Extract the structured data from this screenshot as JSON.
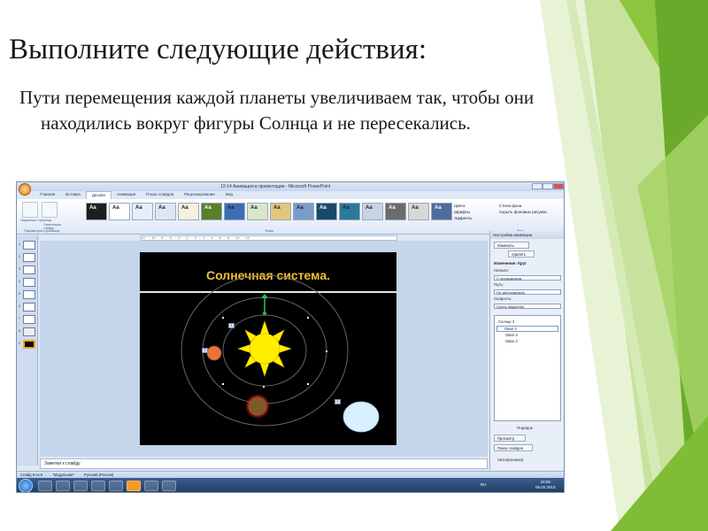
{
  "slide": {
    "title": "Выполните следующие действия:",
    "body": "Пути перемещения каждой планеты увеличиваем так, чтобы они находились вокруг фигуры Солнца и не пересекались."
  },
  "colors": {
    "accent_green": "#8cc63f",
    "slide_heading": "#f4c130",
    "sun": "#ffee00",
    "planet_mars": "#e8743b",
    "planet_earth": "#7a5a2a",
    "planet_ice": "#d8f0ff"
  },
  "app": {
    "window_title": "12-14 Анимация в презентации - Microsoft PowerPoint",
    "office_icon": "office-orb-icon",
    "tabs": [
      "Главная",
      "Вставка",
      "Дизайн",
      "Анимация",
      "Показ слайдов",
      "Рецензирование",
      "Вид"
    ],
    "active_tab": "Дизайн",
    "ribbon_page_buttons": [
      "Параметры страницы",
      "Ориентация слайда"
    ],
    "group_page_setup": "Параметры страницы",
    "group_themes": "Темы",
    "group_background": "Фон",
    "theme_tile_label": "Aa",
    "theme_options": [
      "Цвета",
      "Шрифты",
      "Эффекты"
    ],
    "background_options": [
      "Стили фона",
      "Скрыть фоновые рисунки"
    ],
    "ruler_text": "12 · · · 10 · · · 8 · · · 6 · · · 4 · · · 2 · · · 0 · · · 2 · · · 4 · · · 6 · · · 8 · · · 10 · · · 12",
    "thumb_numbers": [
      "1",
      "2",
      "3",
      "4",
      "5",
      "6",
      "7",
      "8",
      "9"
    ]
  },
  "embedded_slide": {
    "heading": "Солнечная система.",
    "marker_labels": [
      "1",
      "2",
      "3"
    ]
  },
  "notes": {
    "placeholder": "Заметки к слайду"
  },
  "task_pane": {
    "title": "Настройка анимации",
    "change_button": "Изменить",
    "remove_button": "Удалить",
    "effect_label": "Изменение: Круг",
    "start_label": "Начало:",
    "start_value": "С предыдущим",
    "path_label": "Путь:",
    "path_value": "Не заблокирован",
    "speed_label": "Скорость:",
    "speed_value": "Очень медленно",
    "list_items": [
      "Солнце 3",
      "Овал 3",
      "Овал 3",
      "Овал 4"
    ],
    "reorder_label": "Порядок",
    "play_button": "Просмотр",
    "slideshow_button": "Показ слайдов",
    "autopreview_label": "Автопросмотр"
  },
  "status_bar": {
    "slide_info": "Слайд 9 из 9",
    "theme": "\"Модульная\"",
    "language": "Русский (Россия)"
  },
  "taskbar": {
    "lang": "RU",
    "time": "18:05",
    "date": "05.02.2013"
  }
}
